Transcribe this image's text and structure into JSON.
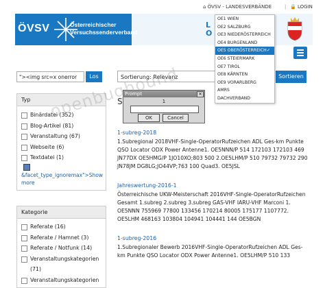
{
  "topbar": {
    "site_link": "ÖVSV - LANDESVERBÄNDE",
    "login_label": "LOGIN",
    "separator": "|"
  },
  "header": {
    "brand": "ÖVSV",
    "org_name_line1": "Österreichischer",
    "org_name_line2": "Versuchssenderverband",
    "partial_text_line1": "L",
    "partial_text_line2": "O"
  },
  "colors": {
    "brand_blue": "#1a78c2",
    "link_blue": "#1a5fa8"
  },
  "region_dropdown": {
    "items": [
      {
        "label": "OE1 WIEN",
        "active": false
      },
      {
        "label": "OE2 SALZBURG",
        "active": false
      },
      {
        "label": "OE3 NIEDERÖSTERREICH",
        "active": false
      },
      {
        "label": "OE4 BURGENLAND",
        "active": false
      },
      {
        "label": "OE5 OBERÖSTERREICH",
        "active": true
      },
      {
        "label": "OE6 STEIERMARK",
        "active": false
      },
      {
        "label": "OE7 TIROL",
        "active": false
      },
      {
        "label": "OE8 KÄRNTEN",
        "active": false
      },
      {
        "label": "OE9 VORARLBERG",
        "active": false
      },
      {
        "label": "AMRS",
        "active": false
      },
      {
        "label": "DACHVERBAND",
        "active": false
      }
    ],
    "check_icon": "✓"
  },
  "search": {
    "value": "\"><img src=x onerror",
    "button_label": "Los"
  },
  "sort": {
    "selected": "Sortierung: Relevanz",
    "button_label": "Sortieren"
  },
  "facets": {
    "typ": {
      "heading": "Typ",
      "items": [
        {
          "label": "Binärdatei (352)"
        },
        {
          "label": "Blog-Artikel (81)"
        },
        {
          "label": "Veranstaltung (67)"
        },
        {
          "label": "Webseite (6)"
        },
        {
          "label": "Textdatei (1)"
        }
      ],
      "link_line1": "&facet_type_ignoremax\">Show",
      "link_line2": "more"
    },
    "kategorie": {
      "heading": "Kategorie",
      "items": [
        {
          "label": "Referate (16)"
        },
        {
          "label": "Referate / Hamnet (3)"
        },
        {
          "label": "Referate / Notfunk (14)"
        },
        {
          "label": "Veranstaltungskategorien"
        },
        {
          "label": "(71)"
        },
        {
          "label": "Veranstaltungskategorien"
        }
      ]
    }
  },
  "results": {
    "partial_heading": "S",
    "items": [
      {
        "title": "1-subreg-2018",
        "body": "1.Subregional 2018VHF-Single-OperatorRufzeichen ADL Ges-km Punkte QSO Locator ODX Power Antenne1. OE5NNN/P 514 172103 172103 469 JN77DX OE5HMG/P 1JO10XO;803 500 2.OE5LHM/P 510 79732 79732 290 JN78JM DG8LG;JO44VP;763 100 Quad3. OE5JSL"
      },
      {
        "title": "Jahreswertung-2016-1",
        "body": "Österreichische UKW-Meisterschaft 2016VHF-Single-OperatorRufzeichen Gesamt 1.subreg 2.subreg 3.subreg GAS-VHF IARU-VHF Marconi 1. OE5NNN 755969 77800 133456 170214 80005 175177 1107772. OE5LHM 468163 103804 104941 104441 144 OE5BGN"
      },
      {
        "title": "1-subreg-2016",
        "body": "1.Subregionaler Bewerb 2016VHF-Single-OperatorRufzeichen ADL Ges-km Punkte QSO Locator ODX Power Antenne1. OE5LHM/P 510 133"
      }
    ]
  },
  "prompt_dialog": {
    "title": "Prompt",
    "message": "1",
    "ok_label": "OK",
    "cancel_label": "Cancel",
    "close_glyph": "×"
  },
  "watermark": "openbughound"
}
